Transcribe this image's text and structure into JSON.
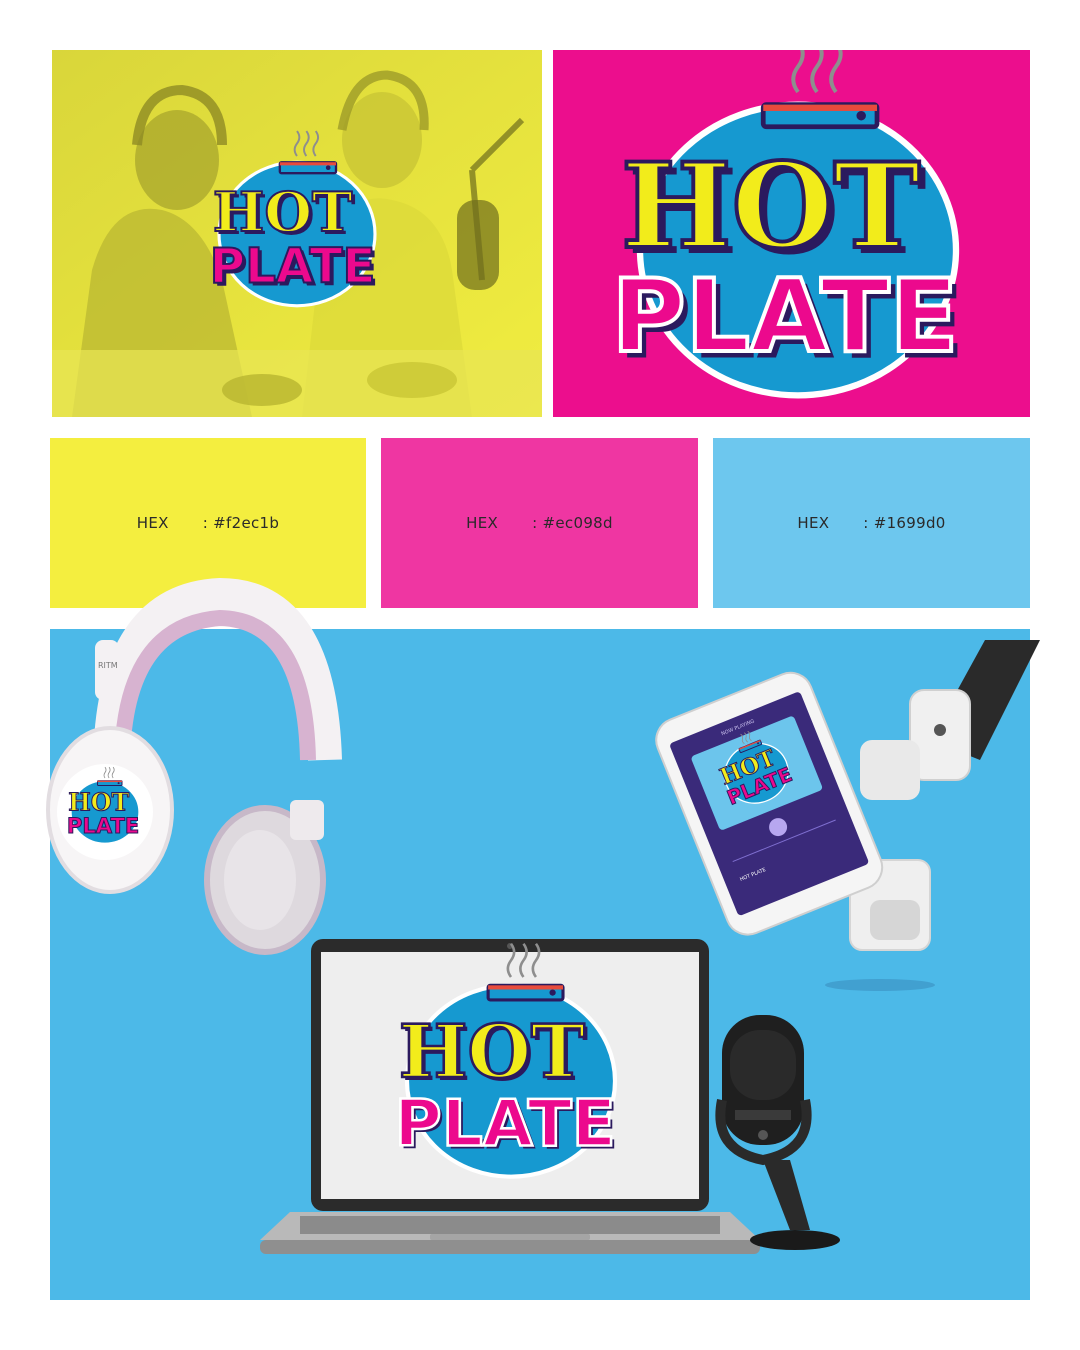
{
  "brand": {
    "line1": "HOT",
    "line2": "PLATE"
  },
  "colors": {
    "yellow": "#f2ec1b",
    "pink": "#ec098d",
    "blue": "#1699d0"
  },
  "swatches": [
    {
      "label": "HEX",
      "value": ": #f2ec1b",
      "color": "#f2ec1b"
    },
    {
      "label": "HEX",
      "value": ": #ec098d",
      "color": "#ec098d"
    },
    {
      "label": "HEX",
      "value": ": #1699d0",
      "color": "#1699d0"
    }
  ],
  "phone": {
    "header": "NOW PLAYING",
    "track_title": "HOT PLATE"
  },
  "headphones": {
    "brand_text": "RITM"
  }
}
